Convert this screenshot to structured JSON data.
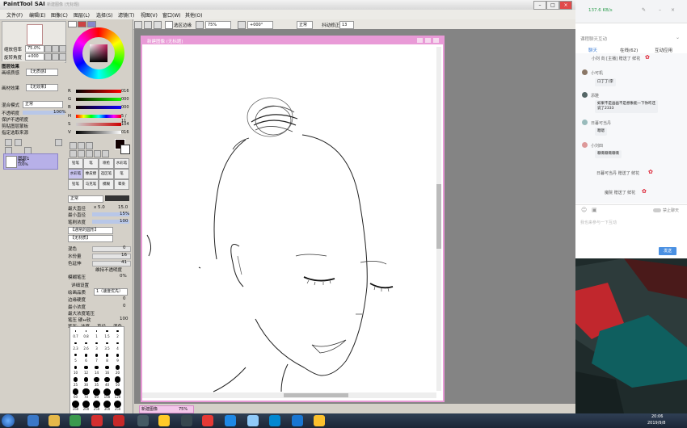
{
  "sai": {
    "title": "PaintTool SAI",
    "doc_title": "新建图像 (无标题)",
    "menus": [
      "文件(F)",
      "编辑(E)",
      "图像(C)",
      "图层(L)",
      "选择(S)",
      "滤镜(T)",
      "视图(V)",
      "窗口(W)",
      "其他(O)"
    ],
    "toolbar": {
      "select_edge": "选区边缘",
      "zoom": "75%",
      "angle": "+000°",
      "mode": "正常",
      "stabilizer_label": "抖动修正",
      "stabilizer": "13"
    },
    "nav": {
      "zoom_label": "缩放倍率",
      "zoom": "75.0%",
      "rotate_label": "旋转角度",
      "rotate": "+000"
    },
    "layer": {
      "effect_header": "图层效果",
      "texture_label": "画纸质感",
      "texture": "【无质感】",
      "effect_label": "画材效果",
      "effect": "【无效果】",
      "blend_label": "混合模式",
      "blend": "正常",
      "opacity_label": "不透明度",
      "opacity": "100%",
      "checks": [
        "保护不透明度",
        "剪贴图层蒙板",
        "指定选取来源"
      ],
      "item_name": "图层1",
      "item_mode": "正常",
      "item_opacity": "100%"
    },
    "color": {
      "mode_tabs": [
        "RGB",
        "HSV"
      ],
      "rgb": [
        "016",
        "000",
        "000"
      ],
      "hsv": [
        "5 / 11",
        "104",
        "016"
      ]
    },
    "tools": [
      "铅笔",
      "笔",
      "喷枪",
      "水彩笔",
      "水彩笔",
      "橡皮擦",
      "选区笔",
      "笔",
      "铅笔",
      "马克笔",
      "模糊",
      "晕染"
    ],
    "brush": {
      "mode": "正常",
      "max_size_label": "最大直径",
      "max_size": "x 5.0",
      "max_size_val": "15.0",
      "min_size_label": "最小直径",
      "min_size": "15%",
      "density_label": "笔刷浓度",
      "density": "100",
      "shape": "【通常的圆形】",
      "texture": "【无材质】",
      "blend_label": "混色",
      "blend": "0",
      "water_label": "水份量",
      "water": "16",
      "keep_label": "色延伸",
      "keep": "41",
      "keep_opacity": "维持不透明度",
      "pressure_label": "模糊笔压",
      "pressure": "0%",
      "detail_header": "详细设置",
      "quality_label": "绘画品质",
      "quality": "1（速度优先）",
      "edge_label": "边缘硬度",
      "edge": "0",
      "min_density_label": "最小浓度",
      "min_density": "0",
      "max_pressure_label": "最大浓度笔压",
      "max_pressure": "100",
      "pressure_sense_label": "笔压 硬↔软",
      "pressure_sense": "100",
      "pressure_opts_label": "笔压:",
      "pressure_opts": [
        "浓度",
        "直径",
        "混色"
      ]
    },
    "size_grid": [
      "0.7",
      "0.8",
      "1",
      "1.5",
      "2",
      "2.3",
      "2.6",
      "3",
      "3.5",
      "4",
      "5",
      "6",
      "7",
      "8",
      "9",
      "10",
      "12",
      "14",
      "16",
      "20",
      "25",
      "30",
      "35",
      "40",
      "50",
      "60",
      "70",
      "80",
      "100",
      "120",
      "160",
      "200",
      "250",
      "300",
      "350"
    ],
    "status_tab": "新建图像",
    "status_zoom": "75%"
  },
  "chat": {
    "speed": "137.6 KB/s",
    "room": "课程聊天互动",
    "tabs": [
      "聊天",
      "在线(62)",
      "互动应用"
    ],
    "messages": [
      {
        "name": "小刘 向 [主播] 赠送了 鲜花",
        "type": "gift"
      },
      {
        "name": "小可机",
        "text": "口丁丁(李"
      },
      {
        "name": "添雅",
        "text": "如果不是画画不是想象能一下你咋还说了2333"
      },
      {
        "name": "日暮可当丹",
        "text": "嗯嗯"
      },
      {
        "name": "小刘四",
        "text": "嘶嘶嘶嘶嘶嘶"
      },
      {
        "name": "日暮可当丹 赠送了 鲜花",
        "type": "gift"
      },
      {
        "name": "魔院 赠送了 鲜花",
        "type": "gift"
      }
    ],
    "mute_label": "禁止聊天",
    "input_placeholder": "我也来参与一下互动",
    "send": "发送"
  },
  "taskbar": {
    "time": "20:06",
    "date": "2019/9/8"
  }
}
